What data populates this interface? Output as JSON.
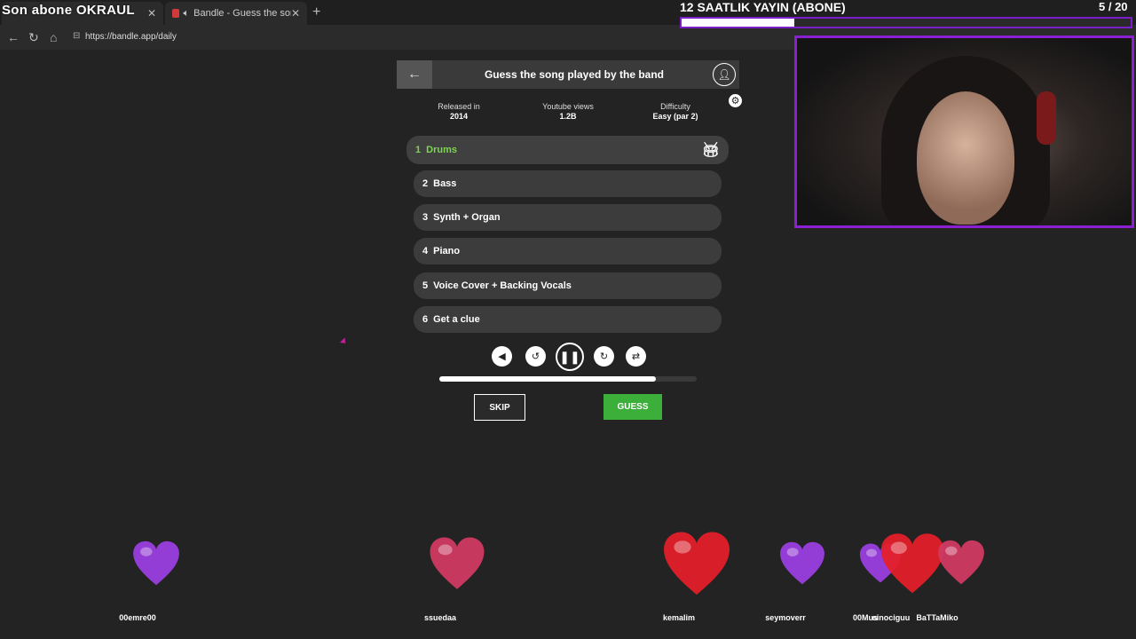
{
  "overlay": {
    "title": "Son abone OKRAUL",
    "banner": "12 SAATLIK YAYIN (ABONE)",
    "banner_progress": 0.25,
    "counter": "5 / 20"
  },
  "browser": {
    "tabs": [
      {
        "label": ""
      },
      {
        "label": "Bandle - Guess the song, one"
      }
    ],
    "url": "https://bandle.app/daily",
    "new_tab": "+"
  },
  "game": {
    "title": "Guess the song played by the band",
    "info": [
      {
        "label": "Released in",
        "value": "2014"
      },
      {
        "label": "Youtube views",
        "value": "1.2B"
      },
      {
        "label": "Difficulty",
        "value": "Easy (par 2)"
      }
    ],
    "tracks": [
      {
        "num": "1",
        "label": "Drums",
        "active": true
      },
      {
        "num": "2",
        "label": "Bass",
        "active": false
      },
      {
        "num": "3",
        "label": "Synth + Organ",
        "active": false
      },
      {
        "num": "4",
        "label": "Piano",
        "active": false
      },
      {
        "num": "5",
        "label": "Voice Cover + Backing Vocals",
        "active": false
      },
      {
        "num": "6",
        "label": "Get a clue",
        "active": false
      }
    ],
    "progress": 0.84,
    "skip_label": "SKIP",
    "guess_label": "GUESS"
  },
  "hearts": [
    {
      "user": "00emre00",
      "color": "#9b3fe0"
    },
    {
      "user": "ssuedaa",
      "color": "#d13a63"
    },
    {
      "user": "kemalim",
      "color": "#e3202a"
    },
    {
      "user": "seymoverr",
      "color": "#9b3fe0"
    },
    {
      "user": "00Mus",
      "color": "#9b3fe0"
    },
    {
      "user": "cinociguu",
      "color": "#e3202a"
    },
    {
      "user": "BaTTaMiko",
      "color": "#d13a63"
    }
  ]
}
